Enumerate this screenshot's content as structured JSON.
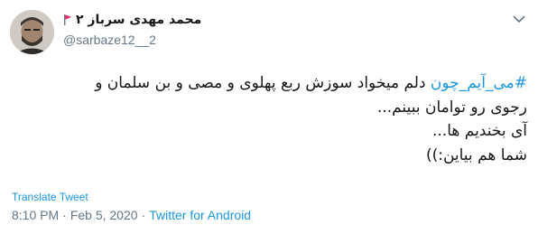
{
  "author": {
    "display_name": "محمد مهدی سرباز ۲",
    "handle": "@sarbaze12__2",
    "flag_color": "#e0245e"
  },
  "tweet": {
    "hashtag": "#می_آیم_چون",
    "line1_rest": " دلم میخواد سوزش ربع پهلوی و مصی و بن سلمان و",
    "line2": "رجوی رو توامان ببینم...",
    "line3": "آی بخندیم ها...",
    "line4": "شما هم بیاین:))"
  },
  "translate_label": "Translate Tweet",
  "meta": {
    "time": "8:10 PM",
    "separator": "·",
    "date": "Feb 5, 2020",
    "source": "Twitter for Android"
  },
  "colors": {
    "link": "#1b95e0",
    "secondary_text": "#657786",
    "primary_text": "#14171a"
  },
  "icons": {
    "menu": "chevron-down-icon",
    "flag": "flag-icon"
  }
}
